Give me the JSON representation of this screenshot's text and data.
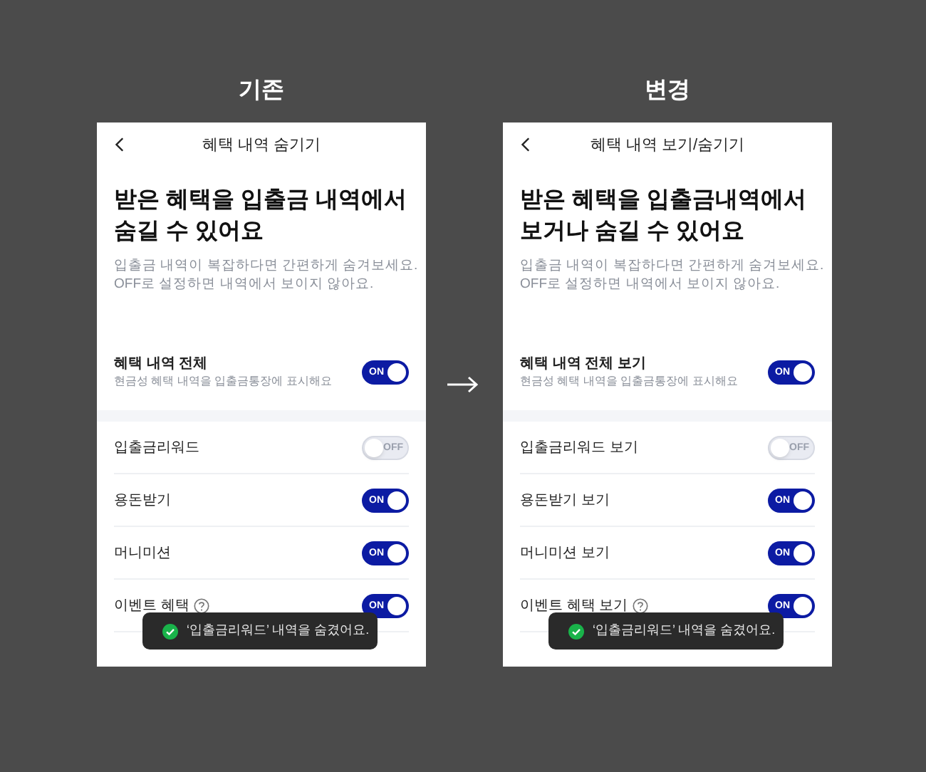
{
  "panels": [
    {
      "caption": "기존",
      "screen": {
        "title": "혜택 내역 숨기기",
        "heading_lines": [
          "받은 혜택을 입출금 내역에서",
          "숨길 수 있어요"
        ],
        "description_lines": [
          "입출금 내역이 복잡하다면 간편하게 숨겨보세요.",
          "OFF로 설정하면 내역에서 보이지 않아요."
        ],
        "master": {
          "label": "혜택 내역 전체",
          "sub": "현금성 혜택 내역을 입출금통장에 표시해요",
          "on": true,
          "toggle_text": "ON"
        },
        "items": [
          {
            "label": "입출금리워드",
            "on": false,
            "toggle_text": "OFF",
            "help": false
          },
          {
            "label": "용돈받기",
            "on": true,
            "toggle_text": "ON",
            "help": false
          },
          {
            "label": "머니미션",
            "on": true,
            "toggle_text": "ON",
            "help": false
          },
          {
            "label": "이벤트 혜택",
            "on": true,
            "toggle_text": "ON",
            "help": true
          }
        ],
        "toast": "‘입출금리워드’ 내역을 숨겼어요."
      }
    },
    {
      "caption": "변경",
      "screen": {
        "title": "혜택 내역 보기/숨기기",
        "heading_lines": [
          "받은 혜택을 입출금내역에서",
          "보거나 숨길 수 있어요"
        ],
        "description_lines": [
          "입출금 내역이 복잡하다면 간편하게 숨겨보세요.",
          "OFF로 설정하면 내역에서 보이지 않아요."
        ],
        "master": {
          "label": "혜택 내역 전체 보기",
          "sub": "현금성 혜택 내역을 입출금통장에 표시해요",
          "on": true,
          "toggle_text": "ON"
        },
        "items": [
          {
            "label": "입출금리워드 보기",
            "on": false,
            "toggle_text": "OFF",
            "help": false
          },
          {
            "label": "용돈받기 보기",
            "on": true,
            "toggle_text": "ON",
            "help": false
          },
          {
            "label": "머니미션 보기",
            "on": true,
            "toggle_text": "ON",
            "help": false
          },
          {
            "label": "이벤트 혜택 보기",
            "on": true,
            "toggle_text": "ON",
            "help": true
          }
        ],
        "toast": "‘입출금리워드’ 내역을 숨겼어요."
      }
    }
  ]
}
